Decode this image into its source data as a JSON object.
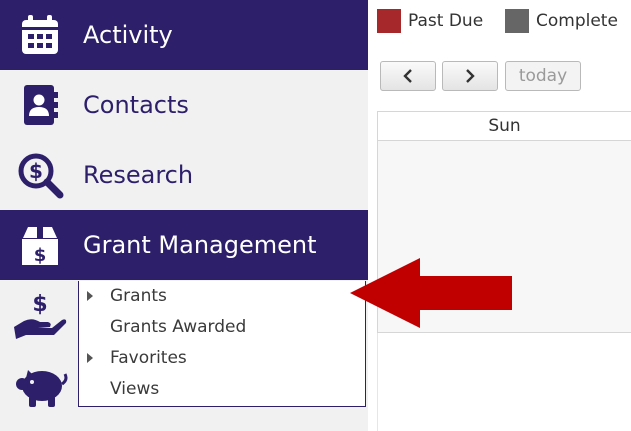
{
  "sidebar": {
    "items": [
      {
        "label": "Activity",
        "icon": "calendar-icon",
        "active": true
      },
      {
        "label": "Contacts",
        "icon": "contact-card-icon",
        "active": false
      },
      {
        "label": "Research",
        "icon": "dollar-search-icon",
        "active": false
      },
      {
        "label": "Grant Management",
        "icon": "money-box-icon",
        "active": true
      }
    ],
    "extra_icons": [
      "hand-dollar-icon",
      "piggy-bank-icon"
    ],
    "submenu": {
      "items": [
        {
          "label": "Grants",
          "has_children": true
        },
        {
          "label": "Grants Awarded",
          "has_children": false
        },
        {
          "label": "Favorites",
          "has_children": true
        },
        {
          "label": "Views",
          "has_children": false
        }
      ]
    }
  },
  "calendar": {
    "legend": [
      {
        "label": "Past Due",
        "color": "#a6282a"
      },
      {
        "label": "Complete",
        "color": "#666666"
      }
    ],
    "toolbar": {
      "prev_icon": "chevron-left-icon",
      "next_icon": "chevron-right-icon",
      "today_label": "today"
    },
    "day_header": "Sun"
  },
  "colors": {
    "brand": "#2e1f6b",
    "arrow": "#c00000"
  }
}
